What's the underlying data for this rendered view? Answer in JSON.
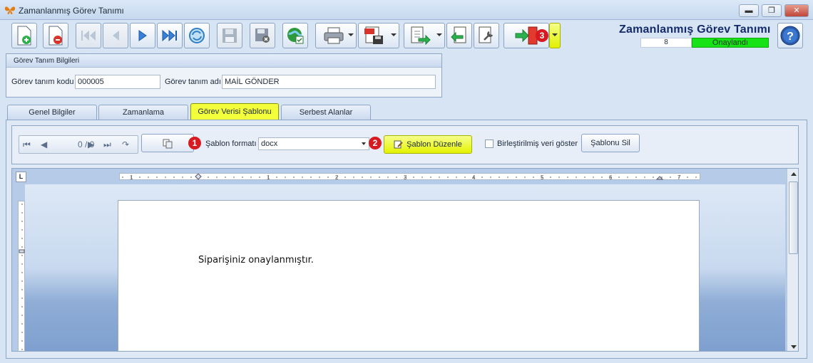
{
  "window": {
    "title": "Zamanlanmış Görev Tanımı",
    "minimize": "▬",
    "maximize": "❐",
    "close": "✕"
  },
  "header": {
    "title": "Zamanlanmış Görev Tanımı",
    "record_count": "8",
    "status": "Onaylandı",
    "status_color": "#16e216"
  },
  "toolbar": {
    "exit_badge": "3",
    "icons": [
      "new-icon",
      "delete-icon",
      "first-icon",
      "prev-icon",
      "next-icon",
      "last-icon",
      "refresh-icon",
      "save-icon",
      "save-close-icon",
      "web-icon",
      "print-icon",
      "pdf-icon",
      "export-icon",
      "import-icon",
      "tools-icon",
      "exit-icon",
      "help-icon"
    ]
  },
  "group": {
    "title": "Görev Tanım Bilgileri",
    "code_label": "Görev tanım kodu",
    "code_value": "000005",
    "name_label": "Görev tanım adı",
    "name_value": "MAİL GÖNDER"
  },
  "tabs": [
    {
      "label": "Genel Bilgiler"
    },
    {
      "label": "Zamanlama"
    },
    {
      "label": "Görev Verisi Şablonu"
    },
    {
      "label": "Serbest Alanlar"
    }
  ],
  "template_toolbar": {
    "nav_count": "0 / 0",
    "badge1": "1",
    "format_label": "Şablon formatı",
    "format_value": "docx",
    "badge2": "2",
    "edit_label": "Şablon Düzenle",
    "merged_label": "Birleştirilmiş veri göster",
    "delete_label": "Şablonu Sil"
  },
  "editor": {
    "corner": "L",
    "ruler_numbers": [
      "1",
      "1",
      "2",
      "3",
      "4",
      "5",
      "6",
      "7"
    ],
    "content": "Siparişiniz onaylanmıştır."
  }
}
